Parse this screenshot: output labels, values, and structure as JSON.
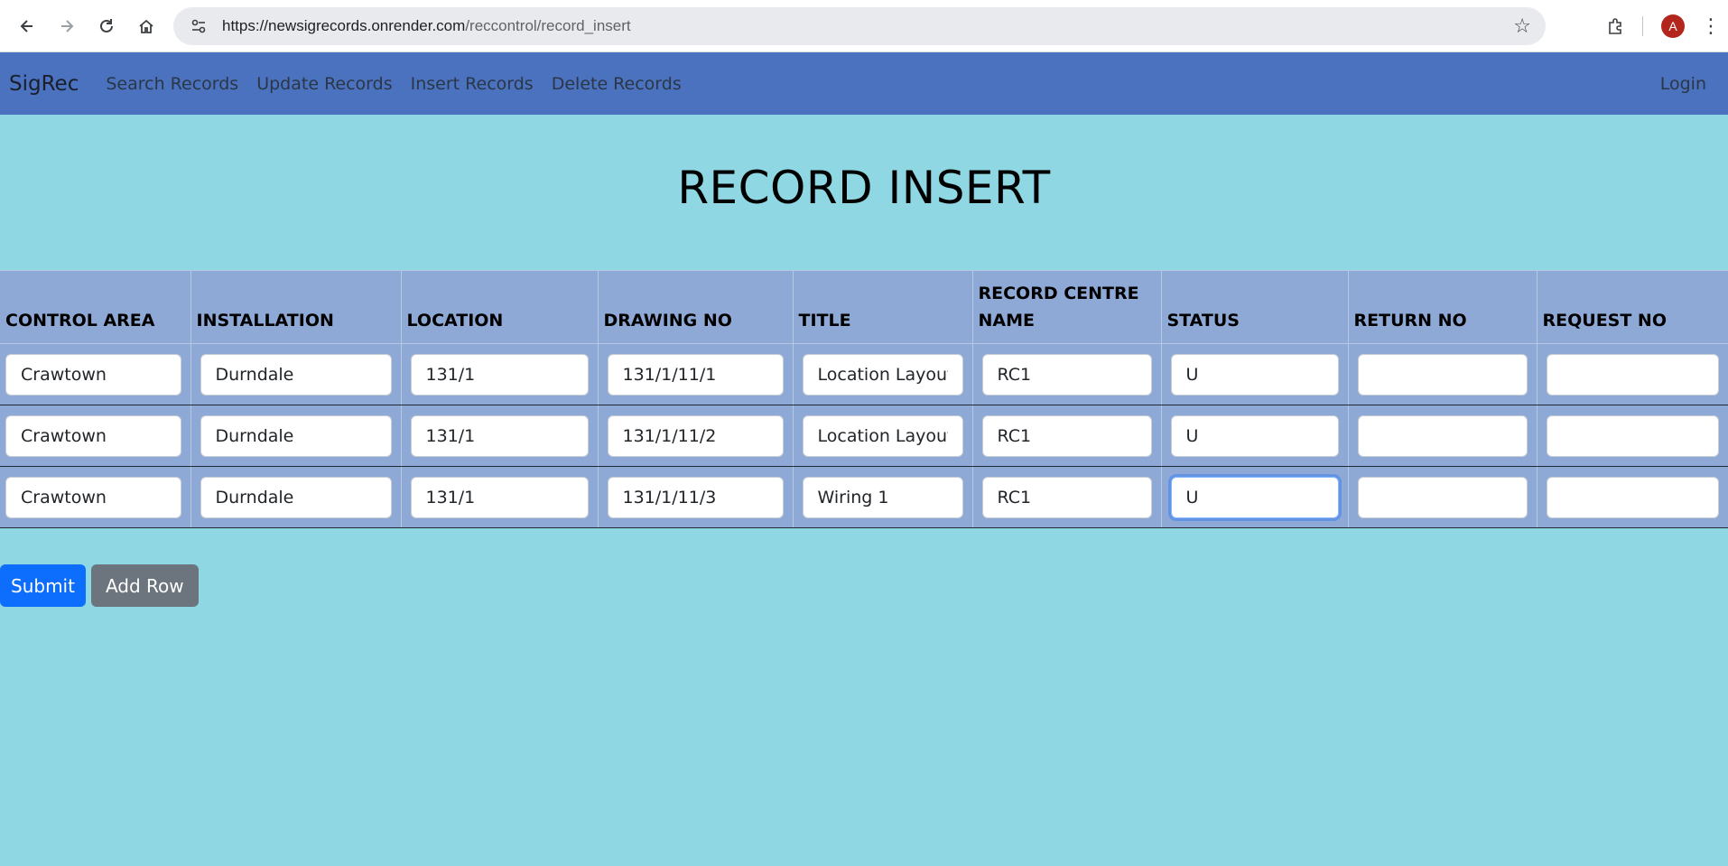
{
  "browser": {
    "url_host": "https://newsigrecords.onrender.com",
    "url_path": "/reccontrol/record_insert",
    "avatar_letter": "A"
  },
  "navbar": {
    "brand": "SigRec",
    "links": [
      "Search Records",
      "Update Records",
      "Insert Records",
      "Delete Records"
    ],
    "login": "Login",
    "color": "#4a72be"
  },
  "page": {
    "title": "RECORD INSERT",
    "background": "#8fd7e3"
  },
  "table": {
    "headers": [
      "CONTROL AREA",
      "INSTALLATION",
      "LOCATION",
      "DRAWING NO",
      "TITLE",
      "RECORD CENTRE NAME",
      "STATUS",
      "RETURN NO",
      "REQUEST NO"
    ],
    "rows": [
      [
        "Crawtown",
        "Durndale",
        "131/1",
        "131/1/11/1",
        "Location Layout",
        "RC1",
        "U",
        "",
        ""
      ],
      [
        "Crawtown",
        "Durndale",
        "131/1",
        "131/1/11/2",
        "Location Layout",
        "RC1",
        "U",
        "",
        ""
      ],
      [
        "Crawtown",
        "Durndale",
        "131/1",
        "131/1/11/3",
        "Wiring 1",
        "RC1",
        "U",
        "",
        ""
      ]
    ]
  },
  "actions": {
    "submit": "Submit",
    "add_row": "Add Row"
  }
}
